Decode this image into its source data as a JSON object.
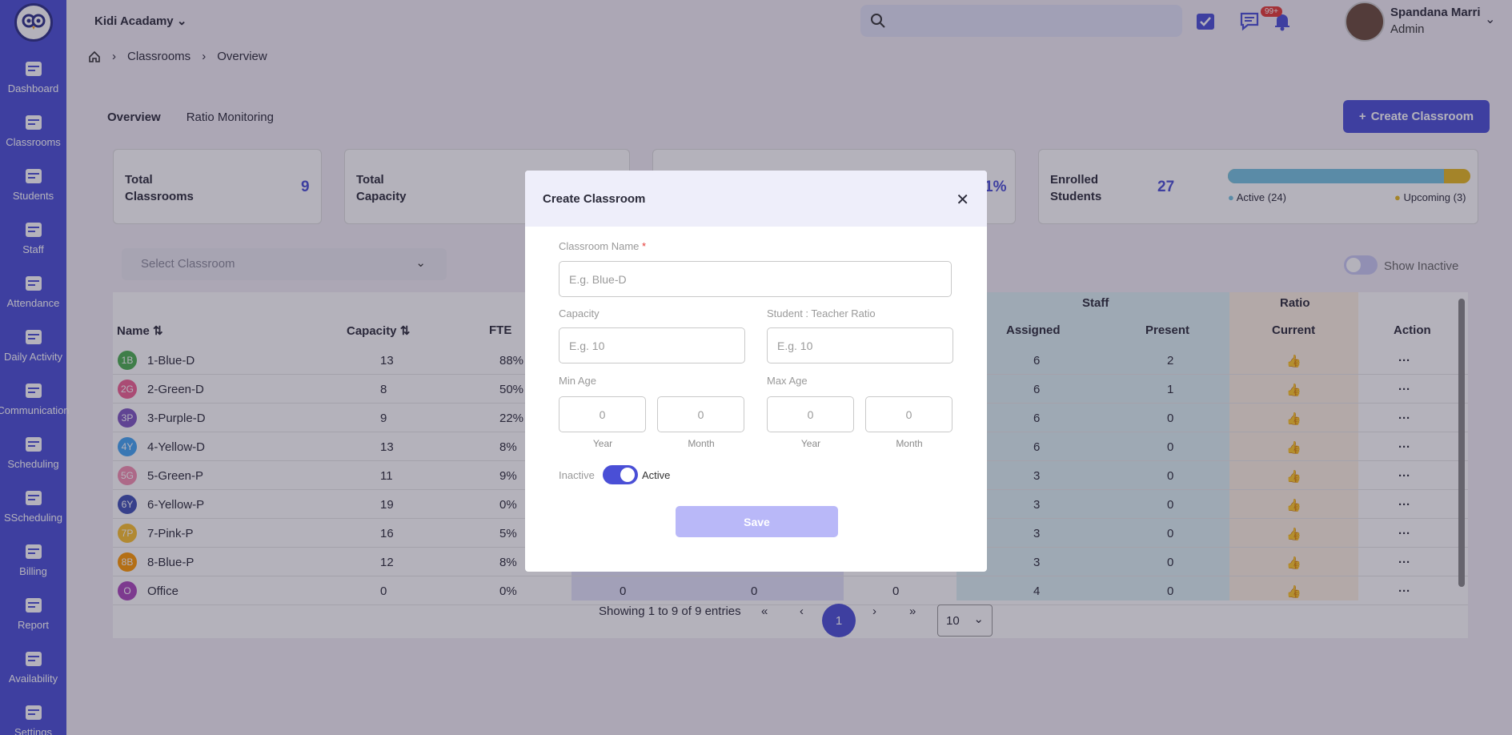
{
  "sidebar": {
    "items": [
      {
        "label": "Dashboard",
        "icon": "dashboard-icon"
      },
      {
        "label": "Classrooms",
        "icon": "classroom-icon"
      },
      {
        "label": "Students",
        "icon": "graduation-cap-icon"
      },
      {
        "label": "Staff",
        "icon": "people-icon"
      },
      {
        "label": "Attendance",
        "icon": "calendar-icon"
      },
      {
        "label": "Daily Activity",
        "icon": "grid-plus-icon"
      },
      {
        "label": "Communication",
        "icon": "chat-icon"
      },
      {
        "label": "Scheduling",
        "icon": "calendar-clock-icon"
      },
      {
        "label": "SScheduling",
        "icon": "calendar-clock-icon"
      },
      {
        "label": "Billing",
        "icon": "dollar-doc-icon"
      },
      {
        "label": "Report",
        "icon": "report-icon"
      },
      {
        "label": "Availability",
        "icon": "availability-icon"
      },
      {
        "label": "Settings",
        "icon": "gear-icon"
      }
    ]
  },
  "header": {
    "org": "Kidi Acadamy",
    "badge": "99+",
    "user_name": "Spandana Marri",
    "user_role": "Admin"
  },
  "breadcrumb": {
    "items": [
      "Classrooms",
      "Overview"
    ]
  },
  "tabs": [
    {
      "label": "Overview"
    },
    {
      "label": "Ratio Monitoring"
    }
  ],
  "create_button": "Create Classroom",
  "cards": {
    "total_classrooms_label": "Total Classrooms",
    "total_classrooms_value": "9",
    "total_capacity_label": "Total Capacity",
    "fte_partial": "1%",
    "enrolled_label": "Enrolled Students",
    "enrolled_value": "27",
    "active_legend": "Active (24)",
    "upcoming_legend": "Upcoming (3)",
    "active_fraction": 0.89
  },
  "filter": {
    "placeholder": "Select Classroom",
    "show_inactive": "Show Inactive"
  },
  "table": {
    "group_staff": "Staff",
    "group_ratio": "Ratio",
    "headers": {
      "name": "Name",
      "capacity": "Capacity",
      "fte": "FTE",
      "assigned": "Assigned",
      "present": "Present",
      "current": "Current",
      "action": "Action"
    },
    "rows": [
      {
        "abbr": "1B",
        "color": "#4caf50",
        "name": "1-Blue-D",
        "capacity": "13",
        "fte": "88%",
        "assigned": "6",
        "present": "2"
      },
      {
        "abbr": "2G",
        "color": "#f06292",
        "name": "2-Green-D",
        "capacity": "8",
        "fte": "50%",
        "assigned": "6",
        "present": "1"
      },
      {
        "abbr": "3P",
        "color": "#7e57c2",
        "name": "3-Purple-D",
        "capacity": "9",
        "fte": "22%",
        "assigned": "6",
        "present": "0"
      },
      {
        "abbr": "4Y",
        "color": "#42a5f5",
        "name": "4-Yellow-D",
        "capacity": "13",
        "fte": "8%",
        "assigned": "6",
        "present": "0"
      },
      {
        "abbr": "5G",
        "color": "#f48fb1",
        "name": "5-Green-P",
        "capacity": "11",
        "fte": "9%",
        "assigned": "3",
        "present": "0"
      },
      {
        "abbr": "6Y",
        "color": "#3f51b5",
        "name": "6-Yellow-P",
        "capacity": "19",
        "fte": "0%",
        "assigned": "3",
        "present": "0"
      },
      {
        "abbr": "7P",
        "color": "#fbc02d",
        "name": "7-Pink-P",
        "capacity": "16",
        "fte": "5%",
        "assigned": "3",
        "present": "0"
      },
      {
        "abbr": "8B",
        "color": "#ff9800",
        "name": "8-Blue-P",
        "capacity": "12",
        "fte": "8%",
        "assigned": "3",
        "present": "0"
      },
      {
        "abbr": "O",
        "color": "#ab47bc",
        "name": "Office",
        "capacity": "0",
        "fte": "0%",
        "col_a": "0",
        "col_b": "0",
        "col_c": "0",
        "assigned": "4",
        "present": "0"
      }
    ]
  },
  "pagination": {
    "summary": "Showing 1 to 9 of 9 entries",
    "page": "1",
    "page_size": "10"
  },
  "modal": {
    "title": "Create Classroom",
    "name_label": "Classroom Name",
    "required_mark": "*",
    "name_placeholder": "E.g. Blue-D",
    "capacity_label": "Capacity",
    "capacity_placeholder": "E.g. 10",
    "ratio_label": "Student : Teacher Ratio",
    "ratio_placeholder": "E.g. 10",
    "min_age_label": "Min Age",
    "max_age_label": "Max Age",
    "zero": "0",
    "year": "Year",
    "month": "Month",
    "inactive": "Inactive",
    "active": "Active",
    "save": "Save"
  }
}
